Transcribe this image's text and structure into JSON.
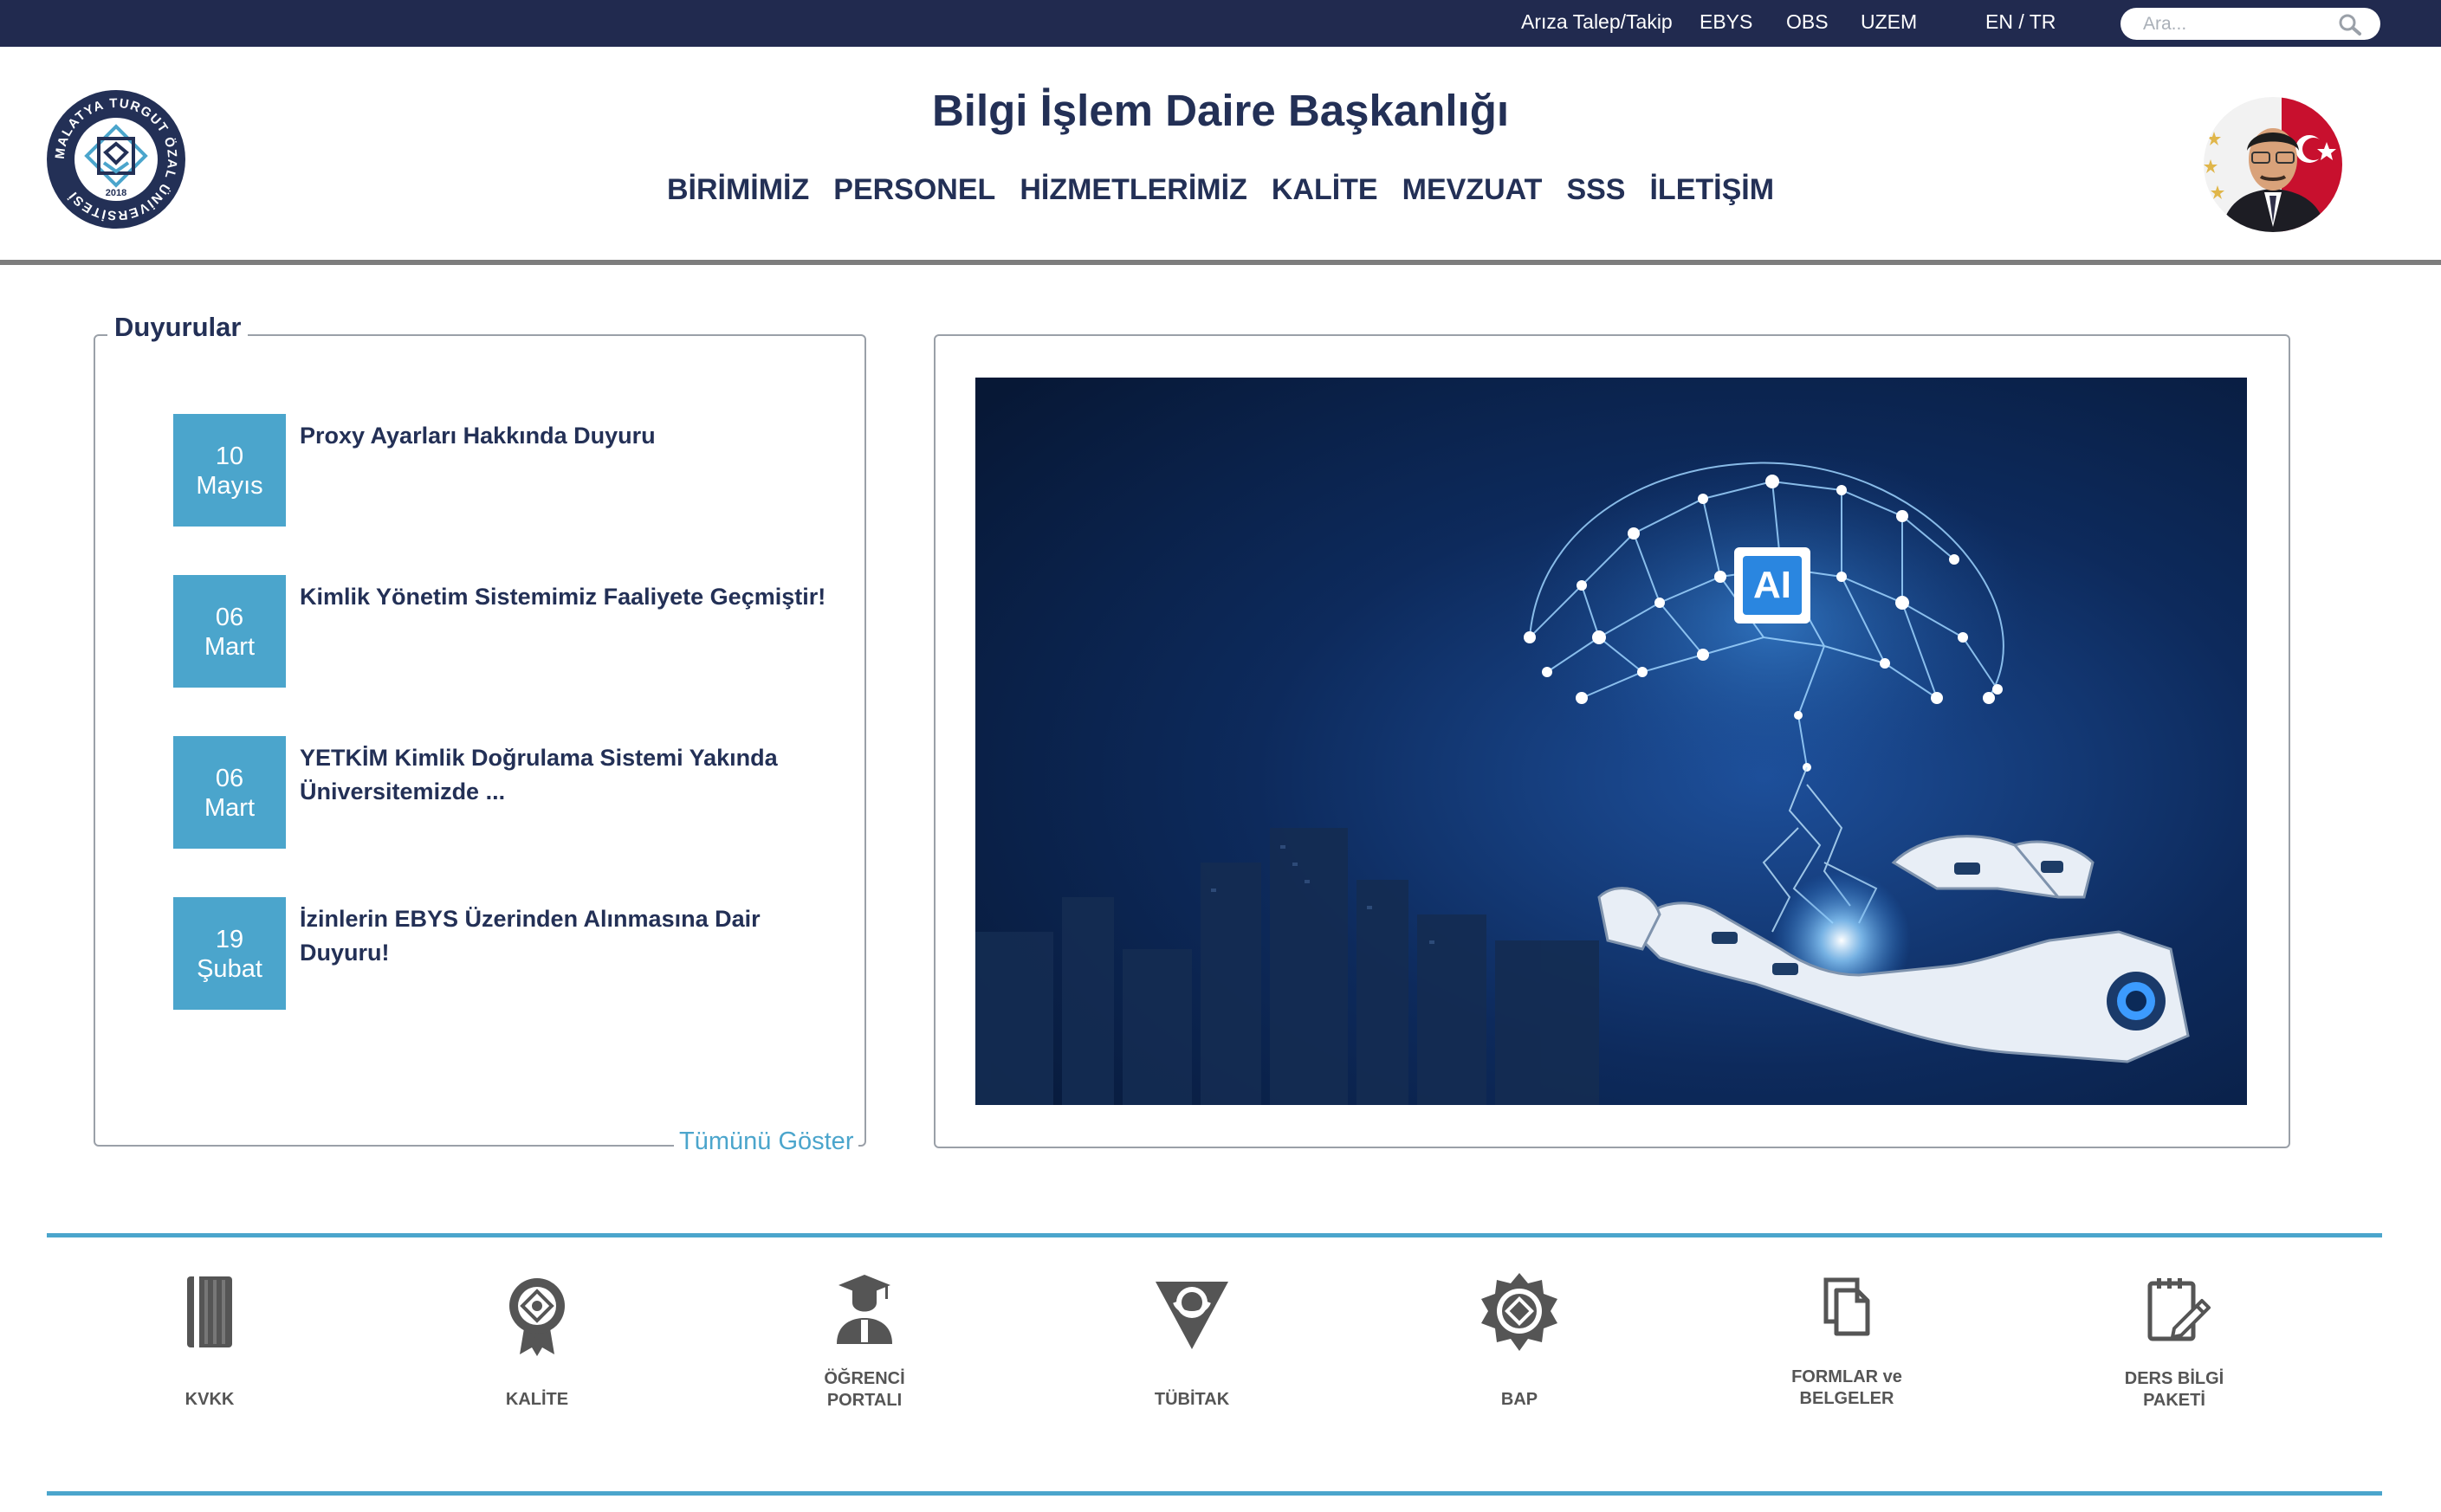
{
  "topbar": {
    "links": [
      "Arıza Talep/Takip",
      "EBYS",
      "OBS",
      "UZEM",
      "EN / TR"
    ],
    "search_placeholder": "Ara..."
  },
  "header": {
    "title": "Bilgi İşlem Daire Başkanlığı",
    "nav": [
      "BİRİMİMİZ",
      "PERSONEL",
      "HİZMETLERİMİZ",
      "KALİTE",
      "MEVZUAT",
      "SSS",
      "İLETİŞİM"
    ],
    "logo_text": "MALATYA TURGUT ÖZAL ÜNİVERSİTESİ",
    "logo_year": "2018"
  },
  "announcements": {
    "title": "Duyurular",
    "items": [
      {
        "day": "10",
        "month": "Mayıs",
        "text": "Proxy Ayarları Hakkında Duyuru"
      },
      {
        "day": "06",
        "month": "Mart",
        "text": "Kimlik Yönetim Sistemimiz Faaliyete Geçmiştir!"
      },
      {
        "day": "06",
        "month": "Mart",
        "text": "YETKİM Kimlik Doğrulama Sistemi Yakında Üniversitemizde ..."
      },
      {
        "day": "19",
        "month": "Şubat",
        "text": "İzinlerin EBYS Üzerinden Alınmasına Dair Duyuru!"
      }
    ],
    "show_all": "Tümünü Göster"
  },
  "slider": {
    "badge": "AI"
  },
  "quick_links": [
    {
      "label1": "KVKK",
      "label2": "",
      "icon": "book-icon"
    },
    {
      "label1": "KALİTE",
      "label2": "",
      "icon": "quality-medal-icon"
    },
    {
      "label1": "ÖĞRENCİ",
      "label2": "PORTALI",
      "icon": "graduate-icon"
    },
    {
      "label1": "TÜBİTAK",
      "label2": "",
      "icon": "tubitak-icon"
    },
    {
      "label1": "BAP",
      "label2": "",
      "icon": "bap-seal-icon"
    },
    {
      "label1": "FORMLAR ve",
      "label2": "BELGELER",
      "icon": "documents-icon"
    },
    {
      "label1": "DERS BİLGİ",
      "label2": "PAKETİ",
      "icon": "course-notes-icon"
    }
  ],
  "colors": {
    "topbar": "#212a4f",
    "title": "#233056",
    "accent": "#4ba5cc",
    "icon_gray": "#555555"
  }
}
